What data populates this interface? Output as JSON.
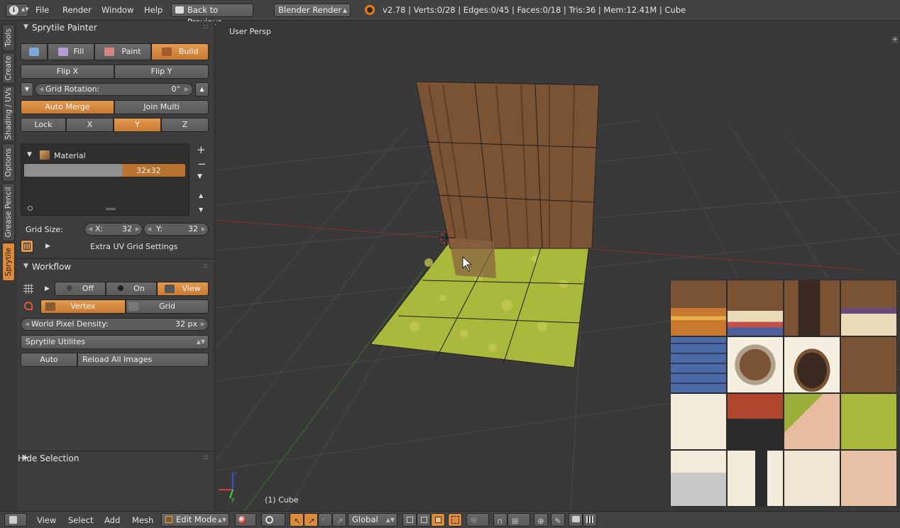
{
  "topbar": {
    "menus": [
      "File",
      "Render",
      "Window",
      "Help"
    ],
    "back_button": "Back to Previous",
    "engine": "Blender Render",
    "stats": "v2.78 | Verts:0/28 | Edges:0/45 | Faces:0/18 | Tris:36 | Mem:12.41M | Cube"
  },
  "tabs": [
    "Tools",
    "Create",
    "Shading / UVs",
    "Options",
    "Grease Pencil",
    "Sprytile"
  ],
  "painter": {
    "title": "Sprytile Painter",
    "modes": [
      "Fill",
      "Paint",
      "Build"
    ],
    "flip_x": "Flip X",
    "flip_y": "Flip Y",
    "grid_rotation_label": "Grid Rotation:",
    "grid_rotation_value": "0°",
    "auto_merge": "Auto Merge",
    "join_multi": "Join Multi",
    "lock": "Lock",
    "axes": [
      "X",
      "Y",
      "Z"
    ],
    "material_label": "Material",
    "material_grid": "32x32",
    "grid_size_label": "Grid Size:",
    "grid_x_label": "X:",
    "grid_x_value": "32",
    "grid_y_label": "Y:",
    "grid_y_value": "32",
    "extra_uv": "Extra UV Grid Settings"
  },
  "workflow": {
    "title": "Workflow",
    "off": "Off",
    "on": "On",
    "view": "View",
    "vertex": "Vertex",
    "grid": "Grid",
    "world_density_label": "World Pixel Density:",
    "world_density_value": "32 px",
    "utilities": "Sprytile Utilites",
    "auto": "Auto",
    "reload": "Reload All Images"
  },
  "hide_selection": "Hide Selection",
  "viewport": {
    "label": "User Persp",
    "object": "(1) Cube"
  },
  "bottombar": {
    "menus": [
      "View",
      "Select",
      "Add",
      "Mesh"
    ],
    "mode": "Edit Mode",
    "orientation": "Global"
  },
  "colors": {
    "accent": "#dd8a3a",
    "wood": "#7a5234",
    "grass": "#a8b83a"
  }
}
